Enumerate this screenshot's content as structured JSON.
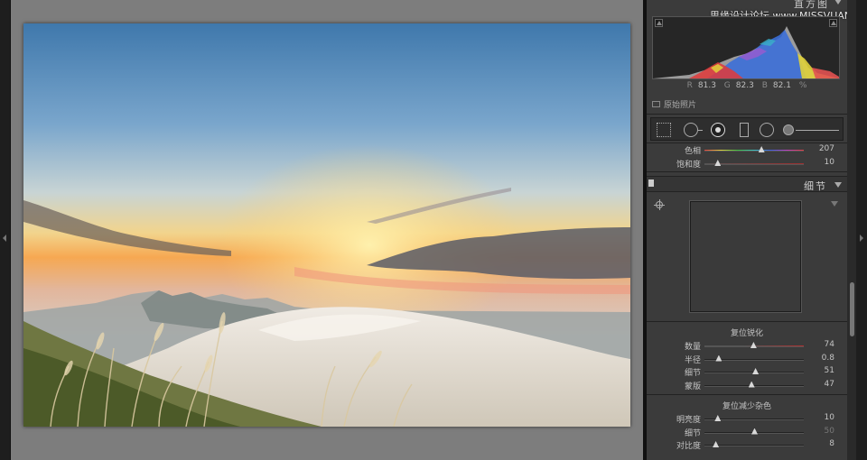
{
  "panel": {
    "histogram_title": "直方图",
    "watermark": "思缘设计论坛 www.MISSVUAN.COM",
    "rgb": {
      "r_label": "R",
      "r": "81.3",
      "g_label": "G",
      "g": "82.3",
      "b_label": "B",
      "b": "82.1",
      "unit": "%"
    },
    "original_photo_label": "原始照片",
    "hsl_sliders": [
      {
        "label": "色相",
        "value": "207",
        "fraction": 0.57,
        "track": "hue"
      },
      {
        "label": "饱和度",
        "value": "10",
        "fraction": 0.13,
        "track": "sat"
      }
    ],
    "detail": {
      "title": "细节",
      "sharpen_title": "复位锐化",
      "sharpen_sliders": [
        {
          "label": "数量",
          "value": "74",
          "fraction": 0.49,
          "track": "red"
        },
        {
          "label": "半径",
          "value": "0.8",
          "fraction": 0.14,
          "track": "plain"
        },
        {
          "label": "细节",
          "value": "51",
          "fraction": 0.51,
          "track": "plain"
        },
        {
          "label": "蒙版",
          "value": "47",
          "fraction": 0.47,
          "track": "plain"
        }
      ],
      "noise_title": "复位减少杂色",
      "noise_sliders": [
        {
          "label": "明亮度",
          "value": "10",
          "fraction": 0.13,
          "track": "plain",
          "dim": false
        },
        {
          "label": "细节",
          "value": "50",
          "fraction": 0.5,
          "track": "plain",
          "dim": true
        },
        {
          "label": "对比度",
          "value": "8",
          "fraction": 0.11,
          "track": "plain",
          "dim": false
        }
      ]
    }
  }
}
